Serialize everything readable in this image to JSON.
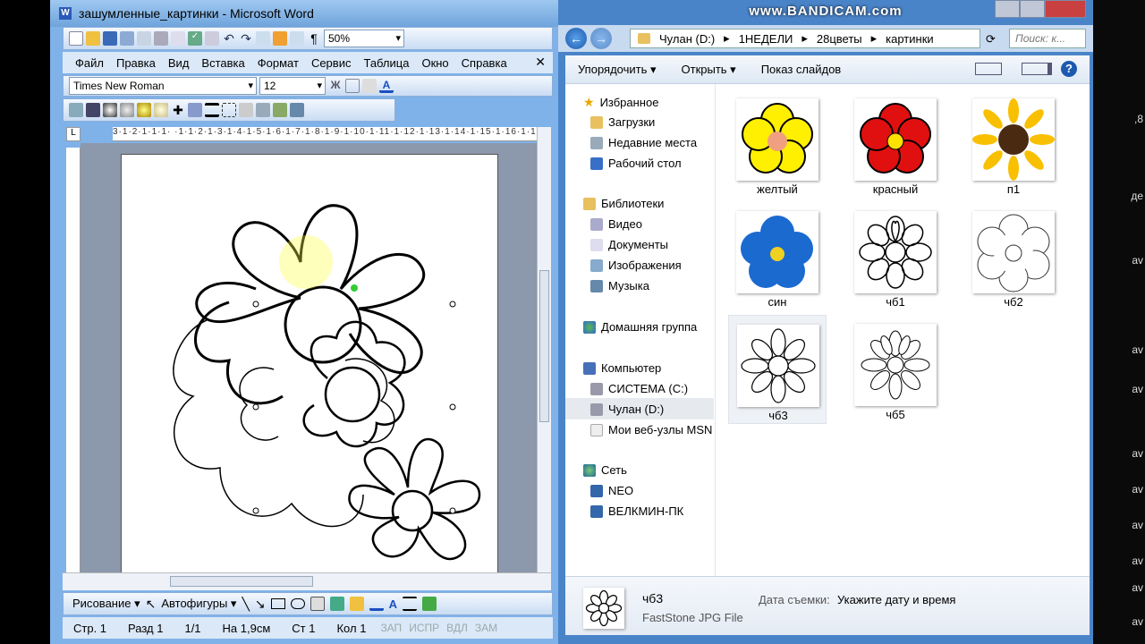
{
  "watermark": "www.BANDICAM.com",
  "word": {
    "title": "зашумленные_картинки - Microsoft Word",
    "zoom": "50%",
    "menu": [
      "Файл",
      "Правка",
      "Вид",
      "Вставка",
      "Формат",
      "Сервис",
      "Таблица",
      "Окно",
      "Справка"
    ],
    "menu_close": "✕",
    "font_name": "Times New Roman",
    "font_size": "12",
    "ruler_text": "3·1·2·1·1·1· ·1·1·2·1·3·1·4·1·5·1·6·1·7·1·8·1·9·1·10·1·11·1·12·1·13·1·14·1·15·1·16·1·17·",
    "drawing_label": "Рисование ▾",
    "autoshapes_label": "Автофигуры ▾",
    "status": {
      "page": "Стр. 1",
      "section": "Разд 1",
      "pages": "1/1",
      "at": "На 1,9см",
      "line": "Ст 1",
      "col": "Кол 1",
      "modes": [
        "ЗАП",
        "ИСПР",
        "ВДЛ",
        "ЗАМ"
      ]
    }
  },
  "explorer": {
    "breadcrumb": [
      "Чулан (D:)",
      "1НЕДЕЛИ",
      "28цветы",
      "картинки"
    ],
    "search_placeholder": "Поиск: к...",
    "toolbar": {
      "organize": "Упорядочить ▾",
      "open": "Открыть ▾",
      "slideshow": "Показ слайдов"
    },
    "nav": {
      "favorites": "Избранное",
      "downloads": "Загрузки",
      "recent": "Недавние места",
      "desktop": "Рабочий стол",
      "libraries": "Библиотеки",
      "video": "Видео",
      "documents": "Документы",
      "images": "Изображения",
      "music": "Музыка",
      "homegroup": "Домашняя группа",
      "computer": "Компьютер",
      "system": "СИСТЕМА (C:)",
      "chulan": "Чулан (D:)",
      "msn": "Мои веб-узлы MSN",
      "network": "Сеть",
      "neo": "NEO",
      "velkmin": "ВЕЛКМИН-ПК"
    },
    "files": [
      "желтый",
      "красный",
      "п1",
      "син",
      "чб1",
      "чб2",
      "чб3",
      "чб5"
    ],
    "details": {
      "name": "чб3",
      "type": "FastStone JPG File",
      "date_label": "Дата съемки:",
      "date_value": "Укажите дату и время"
    }
  },
  "edge_text": [
    ",8",
    "де",
    "av",
    "av",
    "av",
    "av",
    "av",
    "av",
    "av",
    "av",
    "av"
  ],
  "colors": {
    "word_chrome": "#7fb2e8",
    "explorer_chrome": "#4a84c8",
    "accent": "#1c5ab0"
  }
}
